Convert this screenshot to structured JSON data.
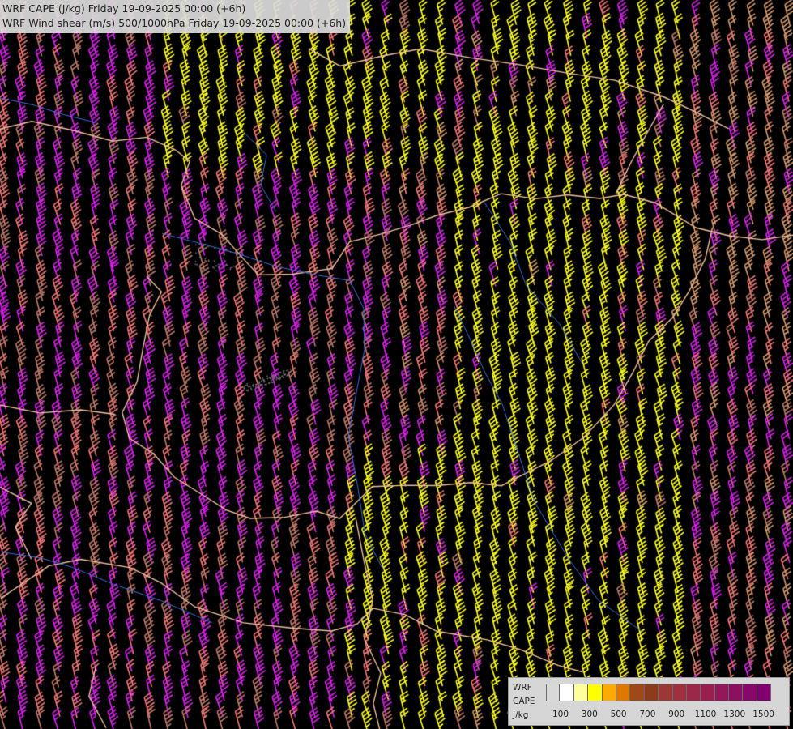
{
  "titles": {
    "line1": "WRF CAPE (J/kg) Friday 19-09-2025 00:00 (+6h)",
    "line2": "WRF Wind shear (m/s) 500/1000hPa Friday 19-09-2025 00:00 (+6h)"
  },
  "legend": {
    "label_model": "WRF",
    "label_field": "CAPE",
    "label_unit": "J/kg",
    "colors": [
      "#d8d8d8",
      "#ffffff",
      "#ffff9a",
      "#ffff00",
      "#ffaa00",
      "#e07800",
      "#a04818",
      "#8c3c1c",
      "#9a3838",
      "#a03040",
      "#9c2848",
      "#982050",
      "#941858",
      "#8c1060",
      "#860868",
      "#800070"
    ],
    "ticks": [
      "100",
      "300",
      "500",
      "700",
      "900",
      "1100",
      "1300",
      "1500"
    ]
  },
  "map": {
    "background": "#000000",
    "border_color": "#f0c0a0",
    "river_color": "#3b6fd8",
    "barb_colors": {
      "magenta": "#dd22ee",
      "salmon": "#f47878",
      "brown": "#c07a6a",
      "tan": "#d49a6e",
      "yellow": "#ffff22"
    }
  }
}
